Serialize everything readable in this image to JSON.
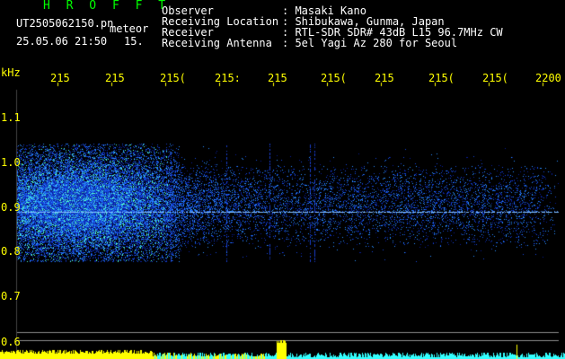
{
  "header": {
    "brand": "H R O F F T",
    "file_name": "UT2505062150.pn",
    "tag": "meteor",
    "date_time": "25.05.06 21:50",
    "counter": "15."
  },
  "info": {
    "labels": [
      "Observer",
      "Receiving Location",
      "Receiver",
      "Receiving Antenna"
    ],
    "values": [
      ": Masaki Kano",
      ": Shibukawa, Gunma, Japan",
      ": RTL-SDR SDR# 43dB L15 96.7MHz CW",
      ": 5el Yagi Az 280 for Seoul"
    ]
  },
  "axes": {
    "unit": "kHz",
    "y_ticks": [
      "1.1",
      "1.0",
      "0.9",
      "0.8",
      "0.7",
      "0.6"
    ],
    "x_ticks": [
      "215",
      "215",
      "215(",
      "215:",
      "215",
      "215(",
      "215",
      "215(",
      "215(",
      "2200"
    ]
  },
  "colors": {
    "background": "#000000",
    "label": "#ffff00",
    "brand": "#00ff00",
    "signal": "#1a6cff",
    "carrier": "#9ecbff",
    "baseline": "#33ffff",
    "peak": "#ffff00"
  }
}
